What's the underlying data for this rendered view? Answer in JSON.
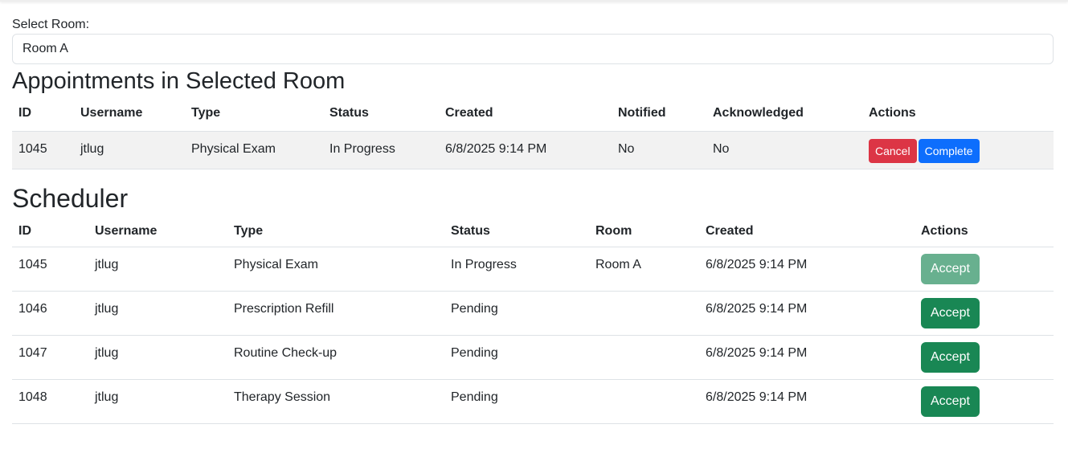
{
  "room_selector": {
    "label": "Select Room:",
    "value": "Room A"
  },
  "room_appointments": {
    "heading": "Appointments in Selected Room",
    "columns": [
      "ID",
      "Username",
      "Type",
      "Status",
      "Created",
      "Notified",
      "Acknowledged",
      "Actions"
    ],
    "rows": [
      {
        "id": "1045",
        "username": "jtlug",
        "type": "Physical Exam",
        "status": "In Progress",
        "created": "6/8/2025 9:14 PM",
        "notified": "No",
        "acknowledged": "No",
        "cancel_label": "Cancel",
        "complete_label": "Complete"
      }
    ]
  },
  "scheduler": {
    "heading": "Scheduler",
    "columns": [
      "ID",
      "Username",
      "Type",
      "Status",
      "Room",
      "Created",
      "Actions"
    ],
    "rows": [
      {
        "id": "1045",
        "username": "jtlug",
        "type": "Physical Exam",
        "status": "In Progress",
        "room": "Room A",
        "created": "6/8/2025 9:14 PM",
        "action_label": "Accept",
        "action_disabled": true
      },
      {
        "id": "1046",
        "username": "jtlug",
        "type": "Prescription Refill",
        "status": "Pending",
        "room": "",
        "created": "6/8/2025 9:14 PM",
        "action_label": "Accept",
        "action_disabled": false
      },
      {
        "id": "1047",
        "username": "jtlug",
        "type": "Routine Check-up",
        "status": "Pending",
        "room": "",
        "created": "6/8/2025 9:14 PM",
        "action_label": "Accept",
        "action_disabled": false
      },
      {
        "id": "1048",
        "username": "jtlug",
        "type": "Therapy Session",
        "status": "Pending",
        "room": "",
        "created": "6/8/2025 9:14 PM",
        "action_label": "Accept",
        "action_disabled": false
      }
    ]
  },
  "colors": {
    "cancel": "#dc3545",
    "complete": "#0d6efd",
    "accept": "#198754",
    "highlight_row": "#f2f2f2"
  }
}
